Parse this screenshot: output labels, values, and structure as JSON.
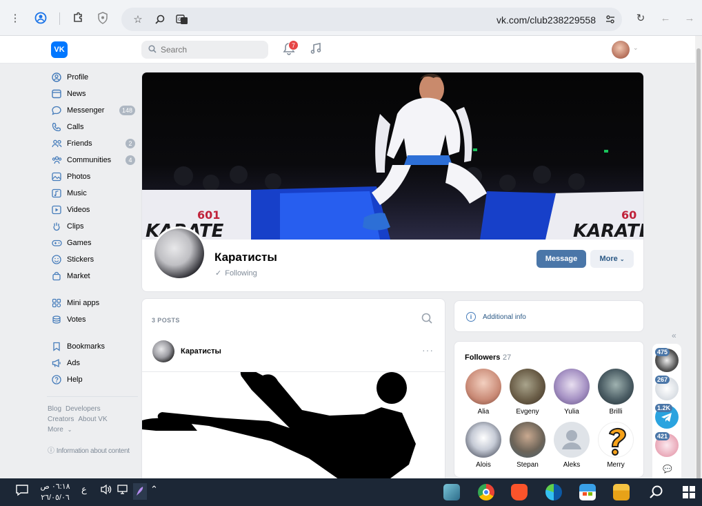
{
  "browser": {
    "url": "vk.com/club238229558"
  },
  "header": {
    "logo_text": "VK",
    "search_placeholder": "Search",
    "notifications_count": "7"
  },
  "sidebar": {
    "items": [
      {
        "label": "Profile",
        "badge": ""
      },
      {
        "label": "News",
        "badge": ""
      },
      {
        "label": "Messenger",
        "badge": "148"
      },
      {
        "label": "Calls",
        "badge": ""
      },
      {
        "label": "Friends",
        "badge": "2"
      },
      {
        "label": "Communities",
        "badge": "4"
      },
      {
        "label": "Photos",
        "badge": ""
      },
      {
        "label": "Music",
        "badge": ""
      },
      {
        "label": "Videos",
        "badge": ""
      },
      {
        "label": "Clips",
        "badge": ""
      },
      {
        "label": "Games",
        "badge": ""
      },
      {
        "label": "Stickers",
        "badge": ""
      },
      {
        "label": "Market",
        "badge": ""
      }
    ],
    "items2": [
      {
        "label": "Mini apps"
      },
      {
        "label": "Votes"
      }
    ],
    "items3": [
      {
        "label": "Bookmarks"
      },
      {
        "label": "Ads"
      },
      {
        "label": "Help"
      }
    ],
    "footer": {
      "blog": "Blog",
      "developers": "Developers",
      "creators": "Creators",
      "about": "About VK",
      "more": "More",
      "info": "Information about content"
    }
  },
  "community": {
    "name": "Каратисты",
    "following": "Following",
    "message_btn": "Message",
    "more_btn": "More",
    "cover_banner_left": "KARATE",
    "cover_banner_right": "KARATE",
    "cover_sign_left": "601",
    "cover_sign_right": "60"
  },
  "posts": {
    "count_label": "3 POSTS",
    "author": "Каратисты"
  },
  "right": {
    "additional_info": "Additional info",
    "followers_title": "Followers",
    "followers_count": "27",
    "followers": [
      {
        "name": "Alia"
      },
      {
        "name": "Evgeny"
      },
      {
        "name": "Yulia"
      },
      {
        "name": "Brilli"
      },
      {
        "name": "Alois"
      },
      {
        "name": "Stepan"
      },
      {
        "name": "Aleks"
      },
      {
        "name": "Merry"
      }
    ]
  },
  "mini_strip": {
    "badges": [
      "475",
      "267",
      "1.2K",
      "421"
    ]
  },
  "taskbar": {
    "time": "٠٦:١٨ ص",
    "date": "٢٦/٠٥/٠٦",
    "lang": "ع"
  }
}
